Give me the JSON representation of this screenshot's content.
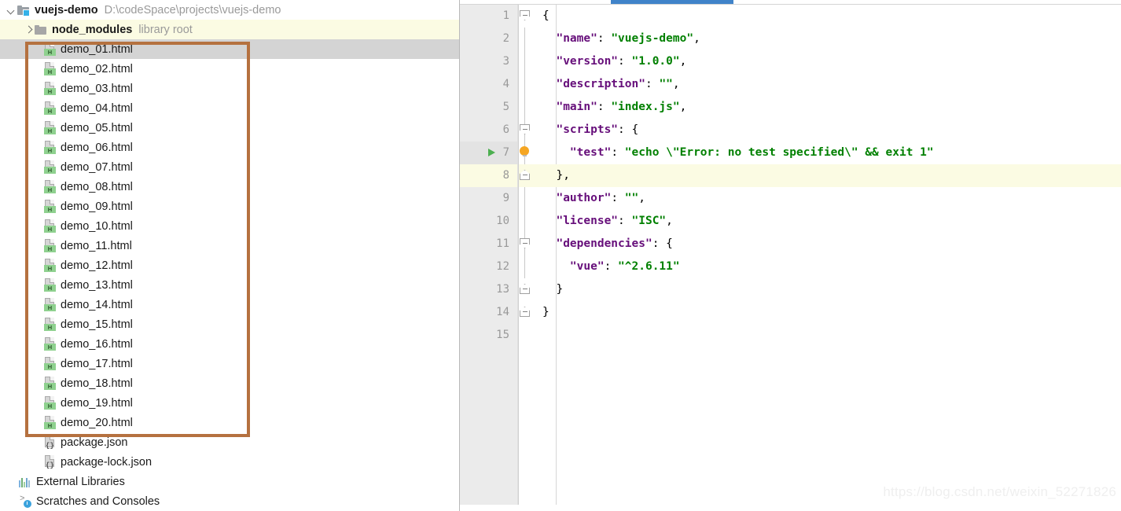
{
  "project": {
    "name": "vuejs-demo",
    "path": "D:\\codeSpace\\projects\\vuejs-demo",
    "twisty": "chevron-down-icon"
  },
  "sidebar": {
    "node_modules": {
      "label": "node_modules",
      "hint": "library root",
      "twisty": "chevron-right-icon"
    },
    "files": [
      {
        "label": "demo_01.html",
        "icon": "html-file-icon",
        "selected": true
      },
      {
        "label": "demo_02.html",
        "icon": "html-file-icon",
        "selected": false
      },
      {
        "label": "demo_03.html",
        "icon": "html-file-icon",
        "selected": false
      },
      {
        "label": "demo_04.html",
        "icon": "html-file-icon",
        "selected": false
      },
      {
        "label": "demo_05.html",
        "icon": "html-file-icon",
        "selected": false
      },
      {
        "label": "demo_06.html",
        "icon": "html-file-icon",
        "selected": false
      },
      {
        "label": "demo_07.html",
        "icon": "html-file-icon",
        "selected": false
      },
      {
        "label": "demo_08.html",
        "icon": "html-file-icon",
        "selected": false
      },
      {
        "label": "demo_09.html",
        "icon": "html-file-icon",
        "selected": false
      },
      {
        "label": "demo_10.html",
        "icon": "html-file-icon",
        "selected": false
      },
      {
        "label": "demo_11.html",
        "icon": "html-file-icon",
        "selected": false
      },
      {
        "label": "demo_12.html",
        "icon": "html-file-icon",
        "selected": false
      },
      {
        "label": "demo_13.html",
        "icon": "html-file-icon",
        "selected": false
      },
      {
        "label": "demo_14.html",
        "icon": "html-file-icon",
        "selected": false
      },
      {
        "label": "demo_15.html",
        "icon": "html-file-icon",
        "selected": false
      },
      {
        "label": "demo_16.html",
        "icon": "html-file-icon",
        "selected": false
      },
      {
        "label": "demo_17.html",
        "icon": "html-file-icon",
        "selected": false
      },
      {
        "label": "demo_18.html",
        "icon": "html-file-icon",
        "selected": false
      },
      {
        "label": "demo_19.html",
        "icon": "html-file-icon",
        "selected": false
      },
      {
        "label": "demo_20.html",
        "icon": "html-file-icon",
        "selected": false
      }
    ],
    "json_files": [
      {
        "label": "package.json",
        "icon": "json-file-icon"
      },
      {
        "label": "package-lock.json",
        "icon": "json-file-icon"
      }
    ],
    "external_libraries": {
      "label": "External Libraries",
      "icon": "libraries-icon"
    },
    "scratches": {
      "label": "Scratches and Consoles",
      "icon": "scratches-icon"
    }
  },
  "annotation": {
    "color": "#b5713f",
    "shape": "rectangle-highlight"
  },
  "editor": {
    "tab_accent_color": "#4083c9",
    "line_numbers": [
      "1",
      "2",
      "3",
      "4",
      "5",
      "6",
      "7",
      "8",
      "9",
      "10",
      "11",
      "12",
      "13",
      "14",
      "15"
    ],
    "current_line": 8,
    "run_line": 7,
    "lines": [
      {
        "n": "1",
        "segments": [
          {
            "t": "{",
            "c": "p"
          }
        ]
      },
      {
        "n": "2",
        "segments": [
          {
            "t": "  ",
            "c": "p"
          },
          {
            "t": "\"name\"",
            "c": "k"
          },
          {
            "t": ": ",
            "c": "p"
          },
          {
            "t": "\"vuejs-demo\"",
            "c": "s"
          },
          {
            "t": ",",
            "c": "p"
          }
        ]
      },
      {
        "n": "3",
        "segments": [
          {
            "t": "  ",
            "c": "p"
          },
          {
            "t": "\"version\"",
            "c": "k"
          },
          {
            "t": ": ",
            "c": "p"
          },
          {
            "t": "\"1.0.0\"",
            "c": "s"
          },
          {
            "t": ",",
            "c": "p"
          }
        ]
      },
      {
        "n": "4",
        "segments": [
          {
            "t": "  ",
            "c": "p"
          },
          {
            "t": "\"description\"",
            "c": "k"
          },
          {
            "t": ": ",
            "c": "p"
          },
          {
            "t": "\"\"",
            "c": "s"
          },
          {
            "t": ",",
            "c": "p"
          }
        ]
      },
      {
        "n": "5",
        "segments": [
          {
            "t": "  ",
            "c": "p"
          },
          {
            "t": "\"main\"",
            "c": "k"
          },
          {
            "t": ": ",
            "c": "p"
          },
          {
            "t": "\"index.js\"",
            "c": "s"
          },
          {
            "t": ",",
            "c": "p"
          }
        ]
      },
      {
        "n": "6",
        "segments": [
          {
            "t": "  ",
            "c": "p"
          },
          {
            "t": "\"scripts\"",
            "c": "k"
          },
          {
            "t": ": {",
            "c": "p"
          }
        ]
      },
      {
        "n": "7",
        "segments": [
          {
            "t": "    ",
            "c": "p"
          },
          {
            "t": "\"test\"",
            "c": "k"
          },
          {
            "t": ": ",
            "c": "p"
          },
          {
            "t": "\"echo \\\"Error: no test specified\\\" && exit 1\"",
            "c": "s"
          }
        ]
      },
      {
        "n": "8",
        "segments": [
          {
            "t": "  },",
            "c": "p"
          }
        ]
      },
      {
        "n": "9",
        "segments": [
          {
            "t": "  ",
            "c": "p"
          },
          {
            "t": "\"author\"",
            "c": "k"
          },
          {
            "t": ": ",
            "c": "p"
          },
          {
            "t": "\"\"",
            "c": "s"
          },
          {
            "t": ",",
            "c": "p"
          }
        ]
      },
      {
        "n": "10",
        "segments": [
          {
            "t": "  ",
            "c": "p"
          },
          {
            "t": "\"license\"",
            "c": "k"
          },
          {
            "t": ": ",
            "c": "p"
          },
          {
            "t": "\"ISC\"",
            "c": "s"
          },
          {
            "t": ",",
            "c": "p"
          }
        ]
      },
      {
        "n": "11",
        "segments": [
          {
            "t": "  ",
            "c": "p"
          },
          {
            "t": "\"dependencies\"",
            "c": "k"
          },
          {
            "t": ": {",
            "c": "p"
          }
        ]
      },
      {
        "n": "12",
        "segments": [
          {
            "t": "    ",
            "c": "p"
          },
          {
            "t": "\"vue\"",
            "c": "k"
          },
          {
            "t": ": ",
            "c": "p"
          },
          {
            "t": "\"^2.6.11\"",
            "c": "s"
          }
        ]
      },
      {
        "n": "13",
        "segments": [
          {
            "t": "  }",
            "c": "p"
          }
        ]
      },
      {
        "n": "14",
        "segments": [
          {
            "t": "}",
            "c": "p"
          }
        ]
      },
      {
        "n": "15",
        "segments": []
      }
    ],
    "gutter_icons": {
      "run": "run-arrow-icon",
      "hint": "lightbulb-icon",
      "fold": "fold-marker-icon"
    }
  },
  "watermark": {
    "text": "https://blog.csdn.net/weixin_52271826"
  }
}
